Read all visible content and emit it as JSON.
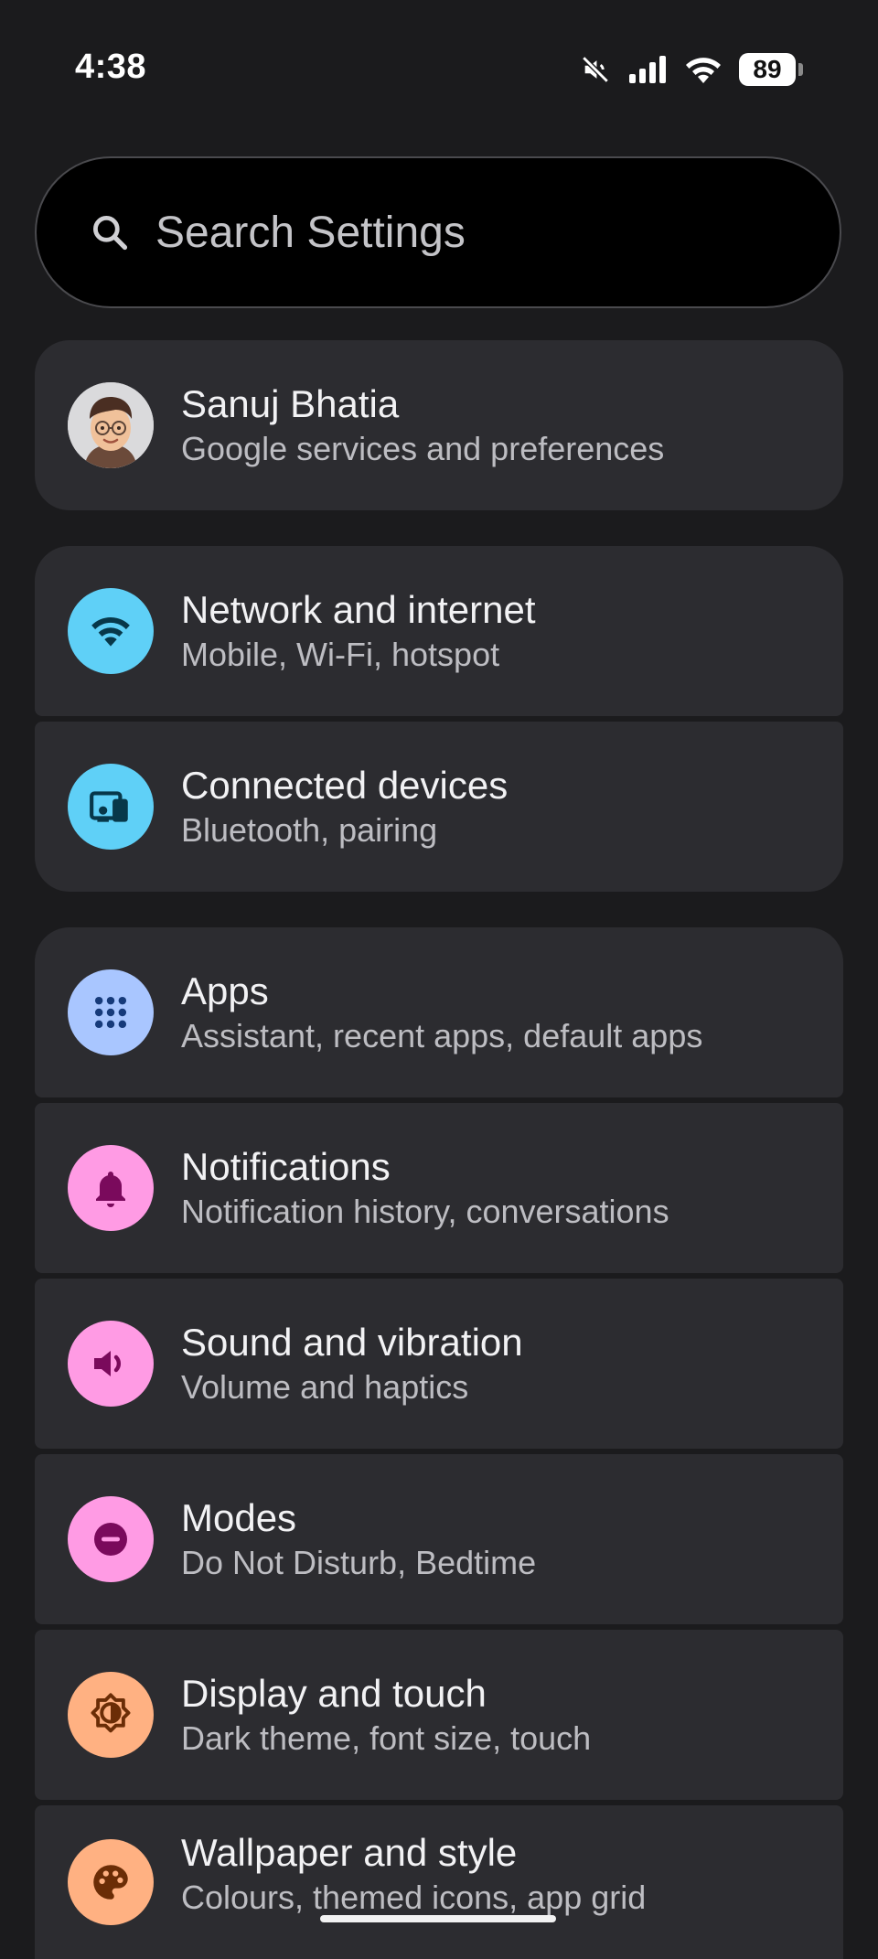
{
  "status_bar": {
    "time": "4:38",
    "battery": "89",
    "icons": [
      "mute-icon",
      "signal-icon",
      "wifi-icon",
      "battery-icon"
    ]
  },
  "search": {
    "placeholder": "Search Settings"
  },
  "account": {
    "name": "Sanuj Bhatia",
    "subtitle": "Google services and preferences"
  },
  "items": [
    {
      "title": "Network and internet",
      "subtitle": "Mobile, Wi-Fi, hotspot",
      "icon": "wifi-icon",
      "color": "#5fd0f7",
      "icon_color": "#07384a"
    },
    {
      "title": "Connected devices",
      "subtitle": "Bluetooth, pairing",
      "icon": "devices-icon",
      "color": "#5fd0f7",
      "icon_color": "#07384a"
    },
    {
      "title": "Apps",
      "subtitle": "Assistant, recent apps, default apps",
      "icon": "apps-grid-icon",
      "color": "#a9c6ff",
      "icon_color": "#163a7a"
    },
    {
      "title": "Notifications",
      "subtitle": "Notification history, conversations",
      "icon": "bell-icon",
      "color": "#ff9be4",
      "icon_color": "#7a0a5c"
    },
    {
      "title": "Sound and vibration",
      "subtitle": "Volume and haptics",
      "icon": "speaker-icon",
      "color": "#ff9be4",
      "icon_color": "#7a0a5c"
    },
    {
      "title": "Modes",
      "subtitle": "Do Not Disturb, Bedtime",
      "icon": "minus-circle-icon",
      "color": "#ff9be4",
      "icon_color": "#7a0a5c"
    },
    {
      "title": "Display and touch",
      "subtitle": "Dark theme, font size, touch",
      "icon": "brightness-icon",
      "color": "#ffb182",
      "icon_color": "#6b2d06"
    },
    {
      "title": "Wallpaper and style",
      "subtitle": "Colours, themed icons, app grid",
      "icon": "palette-icon",
      "color": "#ffb182",
      "icon_color": "#6b2d06"
    }
  ]
}
